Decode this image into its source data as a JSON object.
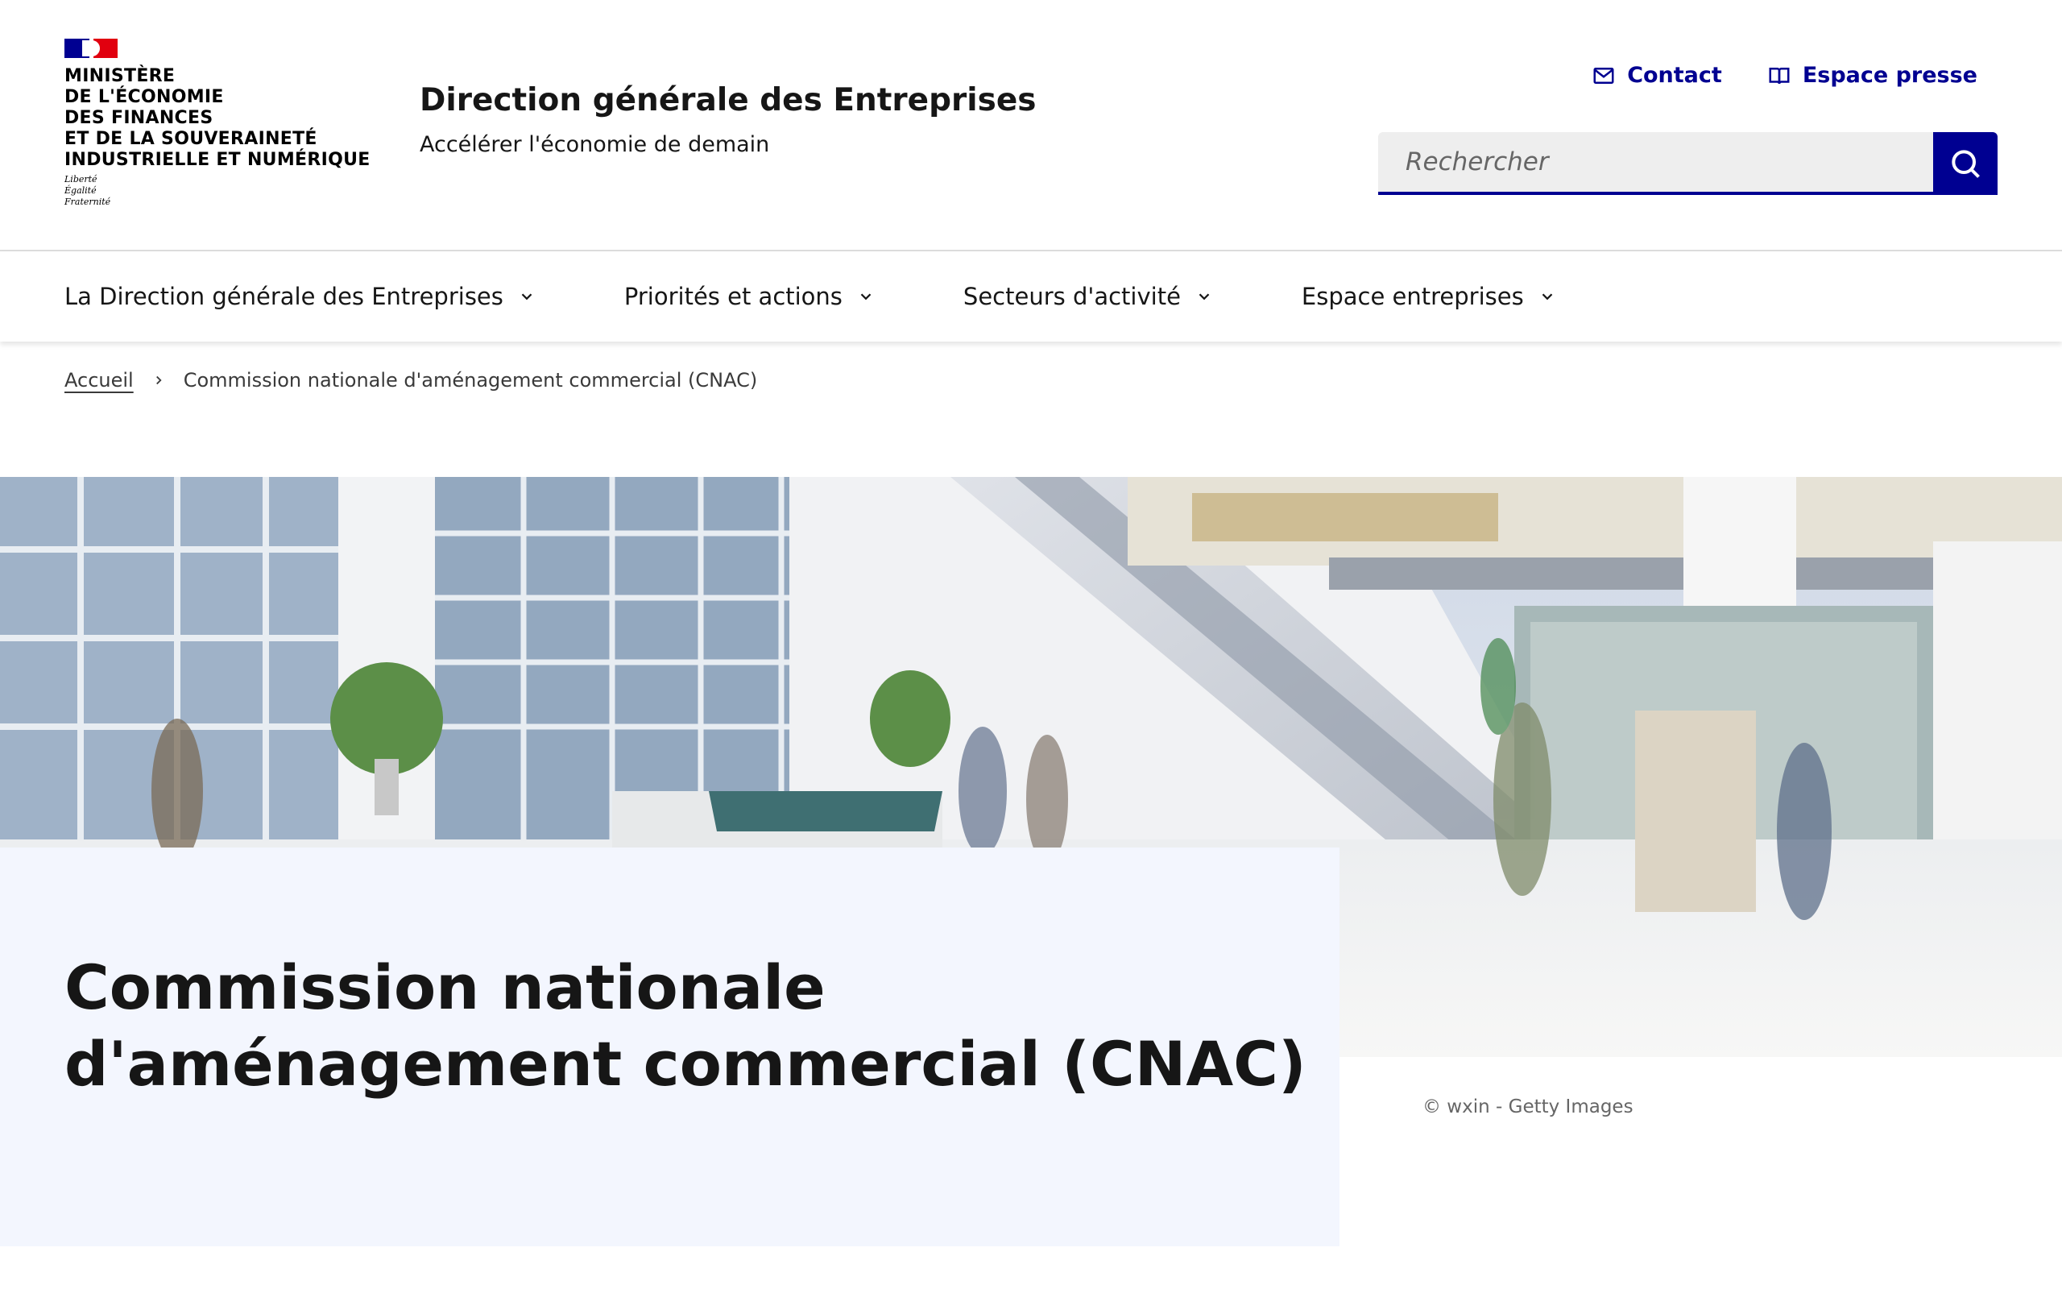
{
  "header": {
    "ministry_lines": [
      "MINISTÈRE",
      "DE L'ÉCONOMIE",
      "DES FINANCES",
      "ET DE LA SOUVERAINETÉ",
      "INDUSTRIELLE ET NUMÉRIQUE"
    ],
    "motto_lines": [
      "Liberté",
      "Égalité",
      "Fraternité"
    ],
    "service_title": "Direction générale des Entreprises",
    "service_tagline": "Accélérer l'économie de demain",
    "tools": [
      {
        "label": "Contact",
        "icon": "mail-icon"
      },
      {
        "label": "Espace presse",
        "icon": "book-icon"
      }
    ],
    "search": {
      "placeholder": "Rechercher",
      "icon": "search-icon"
    }
  },
  "nav": {
    "items": [
      {
        "label": "La Direction générale des Entreprises",
        "icon": "chevron-down-icon"
      },
      {
        "label": "Priorités et actions",
        "icon": "chevron-down-icon"
      },
      {
        "label": "Secteurs d'activité",
        "icon": "chevron-down-icon"
      },
      {
        "label": "Espace entreprises",
        "icon": "chevron-down-icon"
      }
    ]
  },
  "breadcrumb": {
    "home": "Accueil",
    "current": "Commission nationale d'aménagement commercial (CNAC)"
  },
  "hero": {
    "title": "Commission nationale d'aménagement commercial (CNAC)",
    "image_credit": "© wxin - Getty Images"
  },
  "colors": {
    "brand_blue": "#000091",
    "brand_red": "#e1000f",
    "panel_bg": "#f3f6fe",
    "text": "#161616"
  }
}
